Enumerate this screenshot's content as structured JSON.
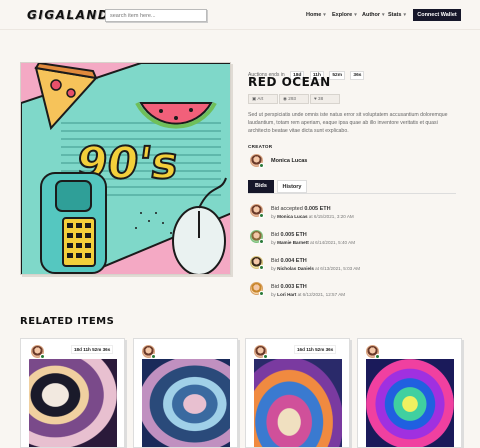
{
  "header": {
    "logo": "GIGALAND",
    "search_placeholder": "search item here...",
    "nav": [
      {
        "label": "Home"
      },
      {
        "label": "Explore"
      },
      {
        "label": "Author"
      },
      {
        "label": "Stats"
      }
    ],
    "connect_label": "Connect Wallet"
  },
  "item": {
    "auction_label": "Auctions ends in",
    "countdown": [
      "18d",
      "11h",
      "52m",
      "36s"
    ],
    "title": "RED OCEAN",
    "stats": [
      {
        "icon": "image-icon",
        "value": "Art"
      },
      {
        "icon": "eye-icon",
        "value": "293"
      },
      {
        "icon": "heart-icon",
        "value": "38"
      }
    ],
    "description": "Sed ut perspiciatis unde omnis iste natus error sit voluptatem accusantium doloremque laudantium, totam rem aperiam, eaque ipsa quae ab illo inventore veritatis et quasi architecto beatae vitae dicta sunt explicabo.",
    "creator_label": "CREATOR",
    "creator_name": "Monica Lucas",
    "tabs": [
      {
        "label": "Bids",
        "active": true
      },
      {
        "label": "History",
        "active": false
      }
    ],
    "bids": [
      {
        "line1_prefix": "Bid accepted ",
        "amount": "0.005 ETH",
        "by": "by ",
        "user": "Monica Lucas",
        "date": " at 6/15/2021, 3:20 AM"
      },
      {
        "line1_prefix": "Bid ",
        "amount": "0.005 ETH",
        "by": "by ",
        "user": "Mamie Barnett",
        "date": " at 6/14/2021, 5:40 AM"
      },
      {
        "line1_prefix": "Bid ",
        "amount": "0.004 ETH",
        "by": "by ",
        "user": "Nicholas Daniels",
        "date": " at 6/13/2021, 5:03 AM"
      },
      {
        "line1_prefix": "Bid ",
        "amount": "0.003 ETH",
        "by": "by ",
        "user": "Lori Hart",
        "date": " at 6/12/2021, 12:57 AM"
      }
    ]
  },
  "related": {
    "title": "RELATED ITEMS",
    "cards": [
      {
        "countdown": "18d 11h 52m 36s",
        "show_countdown": true
      },
      {
        "countdown": "",
        "show_countdown": false
      },
      {
        "countdown": "16d 11h 52m 36s",
        "show_countdown": true
      },
      {
        "countdown": "",
        "show_countdown": false
      }
    ]
  },
  "colors": {
    "background": "#f9f6f2",
    "accent_dark": "#16172a",
    "art_bg": "#f4a9c4",
    "art_teal": "#7fd8c9"
  }
}
